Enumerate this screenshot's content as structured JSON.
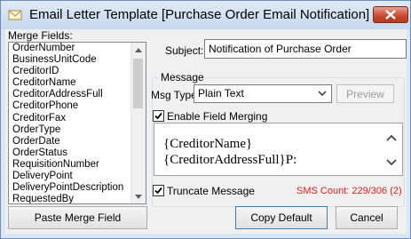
{
  "window": {
    "title": "Email Letter Template [Purchase Order Email Notification]"
  },
  "merge_fields": {
    "label": "Merge Fields:",
    "items": [
      "OrderNumber",
      "BusinessUnitCode",
      "CreditorID",
      "CreditorName",
      "CreditorAddressFull",
      "CreditorPhone",
      "CreditorFax",
      "OrderType",
      "OrderDate",
      "OrderStatus",
      "RequisitionNumber",
      "DeliveryPoint",
      "DeliveryPointDescription",
      "RequestedBy"
    ]
  },
  "subject": {
    "label": "Subject:",
    "value": "Notification of Purchase Order"
  },
  "message": {
    "group_label": "Message",
    "msg_type_label": "Msg Type:",
    "msg_type_value": "Plain Text",
    "preview_label": "Preview",
    "enable_merging_label": "Enable Field Merging",
    "enable_merging_checked": true,
    "body_lines": [
      "{CreditorName}",
      "{CreditorAddressFull}P:"
    ]
  },
  "truncate": {
    "label": "Truncate Message",
    "checked": true
  },
  "sms_count": "SMS Count: 229/306 (2)",
  "buttons": {
    "paste_merge_field": "Paste Merge Field",
    "copy_default": "Copy Default",
    "cancel": "Cancel"
  },
  "colors": {
    "sms_count": "#e0201e",
    "title_bar": "#c6d9ee",
    "close_button": "#c6462f"
  }
}
